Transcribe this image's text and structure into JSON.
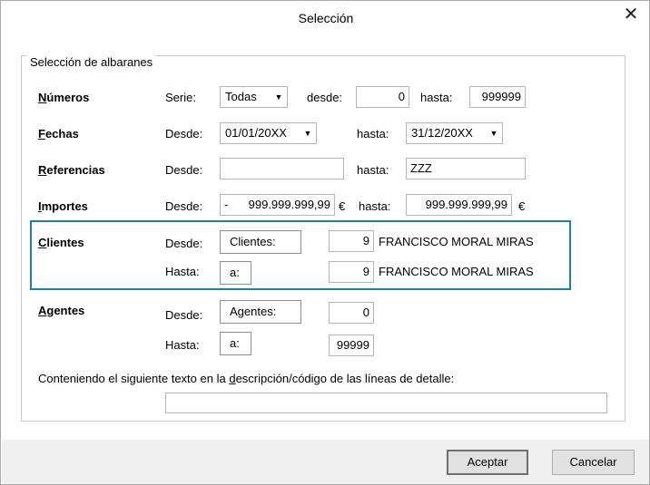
{
  "dialog": {
    "title": "Selección",
    "close_glyph": "✕",
    "group_title": "Selección de albaranes"
  },
  "numeros": {
    "label_pre": "",
    "label_u": "N",
    "label_rest": "úmeros",
    "serie_label": "Serie:",
    "serie_value": "Todas",
    "desde_label": "desde:",
    "desde_value": "0",
    "hasta_label": "hasta:",
    "hasta_value": "999999"
  },
  "fechas": {
    "label_u": "F",
    "label_rest": "echas",
    "desde_label": "Desde:",
    "desde_value": "01/01/20XX",
    "hasta_label": "hasta:",
    "hasta_value": "31/12/20XX"
  },
  "referencias": {
    "label_u": "R",
    "label_rest": "eferencias",
    "desde_label": "Desde:",
    "desde_value": "",
    "hasta_label": "hasta:",
    "hasta_value": "ZZZ"
  },
  "importes": {
    "label_u": "I",
    "label_rest": "mportes",
    "desde_label": "Desde:",
    "desde_sign": "-",
    "desde_value": "999.999.999,99",
    "currency": "€",
    "hasta_label": "hasta:",
    "hasta_value": "999.999.999,99"
  },
  "clientes": {
    "label_u": "C",
    "label_rest": "lientes",
    "desde_label": "Desde:",
    "desde_button": "Clientes:",
    "desde_code": "9",
    "desde_name": "FRANCISCO MORAL MIRAS",
    "hasta_label": "Hasta:",
    "hasta_button": "a:",
    "hasta_code": "9",
    "hasta_name": "FRANCISCO MORAL MIRAS"
  },
  "agentes": {
    "label_u": "A",
    "label_rest": "gentes",
    "desde_label": "Desde:",
    "desde_button": "Agentes:",
    "desde_code": "0",
    "hasta_label": "Hasta:",
    "hasta_button": "a:",
    "hasta_code": "99999"
  },
  "texto": {
    "label_pre": "Conteniendo el siguiente texto en la ",
    "label_u": "d",
    "label_rest": "escripción/código de las líneas de detalle:",
    "value": ""
  },
  "buttons": {
    "accept": "Aceptar",
    "cancel": "Cancelar"
  }
}
